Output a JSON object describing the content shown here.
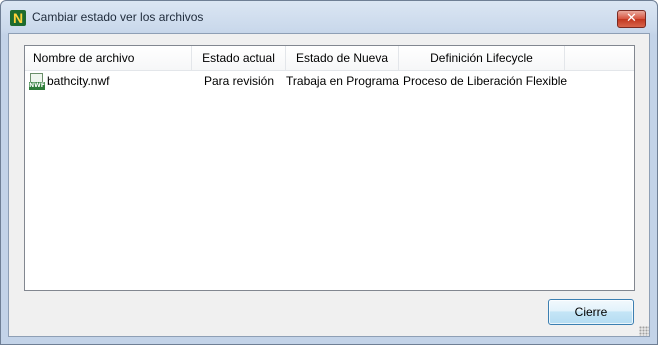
{
  "window": {
    "title": "Cambiar estado ver los archivos",
    "icon": "navisworks-app-icon",
    "close_glyph": "✕"
  },
  "list": {
    "columns": [
      {
        "label": "Nombre de archivo"
      },
      {
        "label": "Estado actual"
      },
      {
        "label": "Estado de Nueva"
      },
      {
        "label": "Definición Lifecycle"
      }
    ],
    "rows": [
      {
        "icon": "nwf-file-icon",
        "icon_text": "NWF",
        "file_name": "bathcity.nwf",
        "current_state": "Para revisión",
        "new_state": "Trabaja en Programa",
        "lifecycle": "Proceso de Liberación Flexible"
      }
    ]
  },
  "buttons": {
    "close_label": "Cierre"
  },
  "colors": {
    "title_gradient_top": "#dbe6f3",
    "close_button_red": "#d7533e",
    "dialog_face": "#f0f0f0",
    "button_blue_border": "#3c7fb1"
  }
}
